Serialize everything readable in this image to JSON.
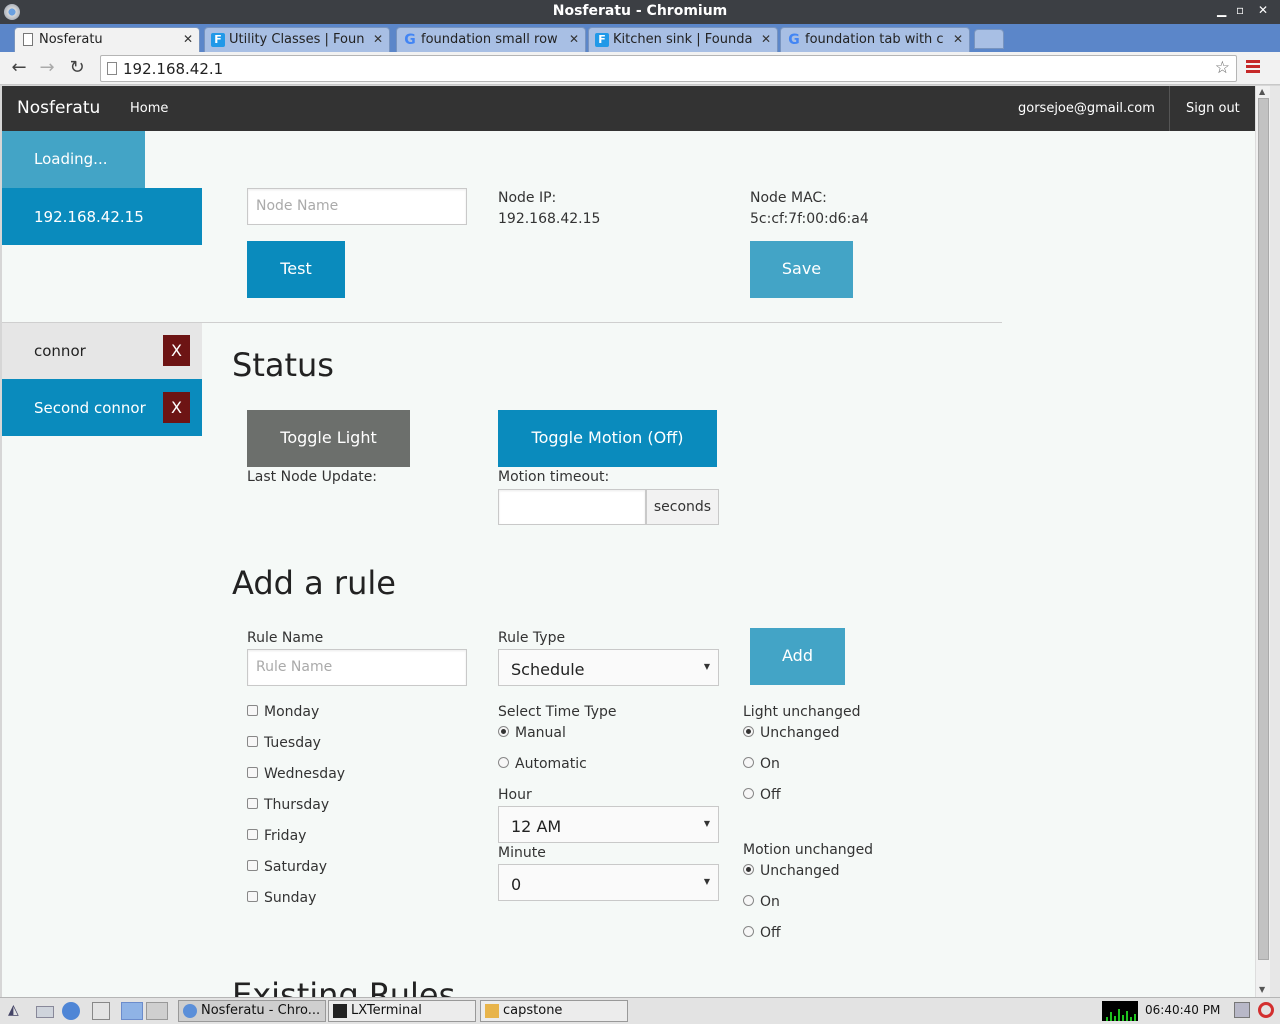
{
  "window": {
    "title": "Nosferatu - Chromium"
  },
  "tabs": [
    {
      "label": "Nosferatu",
      "icon": "page-icon",
      "active": true
    },
    {
      "label": "Utility Classes | Foun",
      "icon": "foundation-icon"
    },
    {
      "label": "foundation small row",
      "icon": "google-icon"
    },
    {
      "label": "Kitchen sink | Founda",
      "icon": "foundation-icon"
    },
    {
      "label": "foundation tab with c",
      "icon": "google-icon"
    }
  ],
  "browser": {
    "url": "192.168.42.1"
  },
  "app": {
    "brand": "Nosferatu",
    "home": "Home",
    "email": "gorsejoe@gmail.com",
    "signout": "Sign out"
  },
  "sidebar": {
    "loading": "Loading...",
    "node": "192.168.42.15",
    "rules": [
      {
        "label": "connor",
        "delete": "X"
      },
      {
        "label": "Second connor",
        "delete": "X"
      }
    ]
  },
  "node": {
    "name_placeholder": "Node Name",
    "ip_label": "Node IP:",
    "ip": "192.168.42.15",
    "mac_label": "Node MAC:",
    "mac": "5c:cf:7f:00:d6:a4",
    "test": "Test",
    "save": "Save"
  },
  "status": {
    "heading": "Status",
    "toggle_light": "Toggle Light",
    "toggle_motion": "Toggle Motion (Off)",
    "last_update_label": "Last Node Update:",
    "motion_timeout_label": "Motion timeout:",
    "motion_timeout_value": "",
    "seconds": "seconds"
  },
  "add_rule": {
    "heading": "Add a rule",
    "rule_name_label": "Rule Name",
    "rule_name_placeholder": "Rule Name",
    "rule_type_label": "Rule Type",
    "rule_type_value": "Schedule",
    "add": "Add",
    "days": [
      "Monday",
      "Tuesday",
      "Wednesday",
      "Thursday",
      "Friday",
      "Saturday",
      "Sunday"
    ],
    "time_type_label": "Select Time Type",
    "time_types": [
      "Manual",
      "Automatic"
    ],
    "time_type_selected": "Manual",
    "hour_label": "Hour",
    "hour_value": "12 AM",
    "minute_label": "Minute",
    "minute_value": "0",
    "light_label": "Light unchanged",
    "light_options": [
      "Unchanged",
      "On",
      "Off"
    ],
    "light_selected": "Unchanged",
    "motion_label": "Motion unchanged",
    "motion_options": [
      "Unchanged",
      "On",
      "Off"
    ],
    "motion_selected": "Unchanged"
  },
  "existing_rules": {
    "heading": "Existing Rules"
  },
  "taskbar": {
    "tasks": [
      "Nosferatu - Chro...",
      "LXTerminal",
      "capstone"
    ],
    "clock": "06:40:40 PM"
  },
  "colors": {
    "primary": "#0a8bbd",
    "secondary_light": "#43a4c6",
    "topbar": "#333333",
    "danger": "#6d1414",
    "toggle_light": "#6c6f6c"
  }
}
